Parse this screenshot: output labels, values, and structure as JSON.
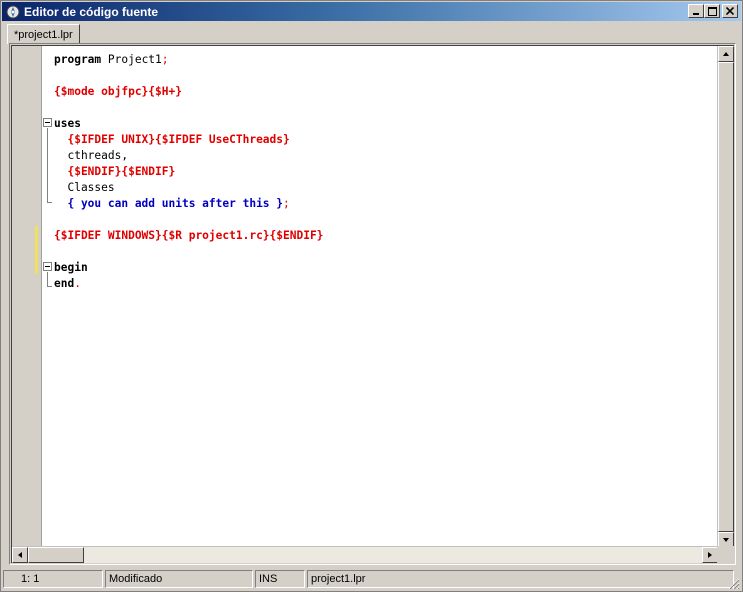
{
  "window": {
    "title": "Editor de código fuente",
    "controls": {
      "minimize": "_",
      "maximize": "□",
      "close": "×"
    }
  },
  "tabs": [
    {
      "label": "*project1.lpr",
      "active": true
    }
  ],
  "editor": {
    "lines": [
      [
        {
          "t": "program",
          "c": "kw"
        },
        {
          "t": " Project1",
          "c": "plain"
        },
        {
          "t": ";",
          "c": "sym"
        }
      ],
      [],
      [
        {
          "t": "{$mode objfpc}{$H+}",
          "c": "dir"
        }
      ],
      [],
      [
        {
          "t": "uses",
          "c": "kw"
        }
      ],
      [
        {
          "t": "  {$IFDEF UNIX}{$IFDEF UseCThreads}",
          "c": "dir"
        }
      ],
      [
        {
          "t": "  cthreads",
          "c": "plain"
        },
        {
          "t": ",",
          "c": "plain"
        }
      ],
      [
        {
          "t": "  {$ENDIF}{$ENDIF}",
          "c": "dir"
        }
      ],
      [
        {
          "t": "  Classes",
          "c": "plain"
        }
      ],
      [
        {
          "t": "  { you can add units after this }",
          "c": "cmt"
        },
        {
          "t": ";",
          "c": "sym"
        }
      ],
      [],
      [
        {
          "t": "{$IFDEF WINDOWS}{$R project1.rc}{$ENDIF}",
          "c": "dir"
        }
      ],
      [],
      [
        {
          "t": "begin",
          "c": "kw"
        }
      ],
      [
        {
          "t": "end",
          "c": "kw"
        },
        {
          "t": ".",
          "c": "sym"
        }
      ]
    ]
  },
  "status": {
    "position": "1:  1",
    "modified": "Modificado",
    "mode": "INS",
    "file": "project1.lpr"
  },
  "colors": {
    "directive": "#e00000",
    "comment": "#0000c0",
    "keyword": "#000000",
    "title_gradient_start": "#0a246a",
    "title_gradient_end": "#a6caf0",
    "modified_marker": "#f0e060"
  },
  "icons": {
    "app": "lazarus-icon",
    "scroll_up": "arrow-up-icon",
    "scroll_down": "arrow-down-icon",
    "scroll_left": "arrow-left-icon",
    "scroll_right": "arrow-right-icon"
  }
}
